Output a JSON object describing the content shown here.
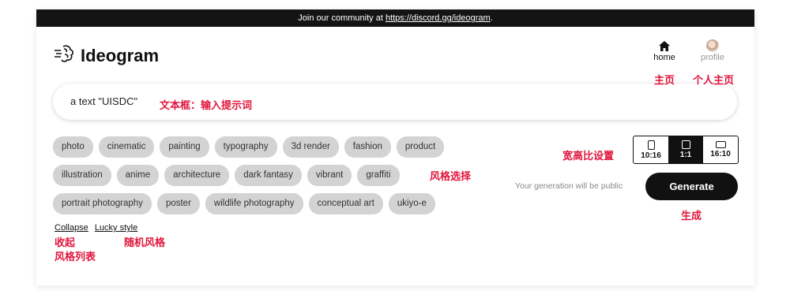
{
  "banner": {
    "prefix": "Join our community at ",
    "link": "https://discord.gg/ideogram",
    "suffix": "."
  },
  "logo": {
    "text": "Ideogram",
    "icon": "brain-icon"
  },
  "nav": {
    "home": "home",
    "profile": "profile"
  },
  "prompt": {
    "value": "a text \"UISDC\""
  },
  "styles": {
    "rows": [
      [
        "photo",
        "cinematic",
        "painting",
        "typography",
        "3d render",
        "fashion",
        "product"
      ],
      [
        "illustration",
        "anime",
        "architecture",
        "dark fantasy",
        "vibrant",
        "graffiti"
      ],
      [
        "portrait photography",
        "poster",
        "wildlife photography",
        "conceptual art",
        "ukiyo-e"
      ]
    ]
  },
  "links": {
    "collapse": "Collapse",
    "lucky": "Lucky style"
  },
  "ratio": {
    "options": [
      "10:16",
      "1:1",
      "16:10"
    ],
    "selected": "1:1"
  },
  "public_note": "Your generation will be public",
  "generate": "Generate",
  "annotations": {
    "home": "主页",
    "profile": "个人主页",
    "prompt": "文本框：输入提示词",
    "ratio": "宽高比设置",
    "styles": "风格选择",
    "generate": "生成",
    "collapse_1": "收起",
    "collapse_2": "风格列表",
    "lucky": "随机风格"
  },
  "colors": {
    "accent": "#e0163c",
    "dark": "#111111",
    "chip": "#d3d3d3"
  }
}
